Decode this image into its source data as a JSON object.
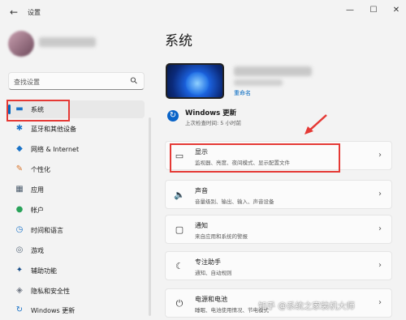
{
  "window": {
    "title": "设置",
    "back_glyph": "←",
    "min_glyph": "—",
    "max_glyph": "☐",
    "close_glyph": "✕"
  },
  "search": {
    "placeholder": "查找设置",
    "icon": "search-icon"
  },
  "sidebar": {
    "items": [
      {
        "label": "系统",
        "icon": "monitor-icon",
        "glyph": "▬",
        "color": "#1a73c8",
        "active": true
      },
      {
        "label": "蓝牙和其他设备",
        "icon": "bluetooth-icon",
        "glyph": "✱",
        "color": "#1a73c8"
      },
      {
        "label": "网络 & Internet",
        "icon": "wifi-icon",
        "glyph": "◆",
        "color": "#1a73c8"
      },
      {
        "label": "个性化",
        "icon": "brush-icon",
        "glyph": "✎",
        "color": "#d9742b"
      },
      {
        "label": "应用",
        "icon": "apps-icon",
        "glyph": "▦",
        "color": "#4a5a6b"
      },
      {
        "label": "帐户",
        "icon": "account-icon",
        "glyph": "●",
        "color": "#2aa35a"
      },
      {
        "label": "时间和语言",
        "icon": "globe-clock-icon",
        "glyph": "◷",
        "color": "#1a73c8"
      },
      {
        "label": "游戏",
        "icon": "gamepad-icon",
        "glyph": "◎",
        "color": "#5b6b7c"
      },
      {
        "label": "辅助功能",
        "icon": "accessibility-icon",
        "glyph": "✦",
        "color": "#1a4f8a"
      },
      {
        "label": "隐私和安全性",
        "icon": "shield-icon",
        "glyph": "◈",
        "color": "#6d7480"
      },
      {
        "label": "Windows 更新",
        "icon": "update-icon",
        "glyph": "↻",
        "color": "#1a73c8"
      }
    ]
  },
  "main": {
    "title": "系统",
    "device": {
      "rename": "重命名"
    },
    "windows_update": {
      "title": "Windows 更新",
      "subtitle": "上次检查时间: 5 小时前",
      "icon_glyph": "↻"
    },
    "cards": [
      {
        "title": "显示",
        "subtitle": "监视器、亮度、夜间模式、显示配置文件",
        "icon": "display-icon",
        "glyph": "▭"
      },
      {
        "title": "声音",
        "subtitle": "音量级别、输出、输入、声音设备",
        "icon": "speaker-icon",
        "glyph": "🔈"
      },
      {
        "title": "通知",
        "subtitle": "来自应用和系统的警报",
        "icon": "notification-icon",
        "glyph": "▢"
      },
      {
        "title": "专注助手",
        "subtitle": "通知、自动规则",
        "icon": "moon-icon",
        "glyph": "☾"
      },
      {
        "title": "电源和电池",
        "subtitle": "睡眠、电池使用情况、节电模式",
        "icon": "power-icon",
        "glyph": "⏻"
      }
    ],
    "chevron": "›"
  },
  "annotations": {
    "highlight_color": "#e53935"
  },
  "watermark": {
    "text": "知乎 @系统之家装机大师"
  }
}
